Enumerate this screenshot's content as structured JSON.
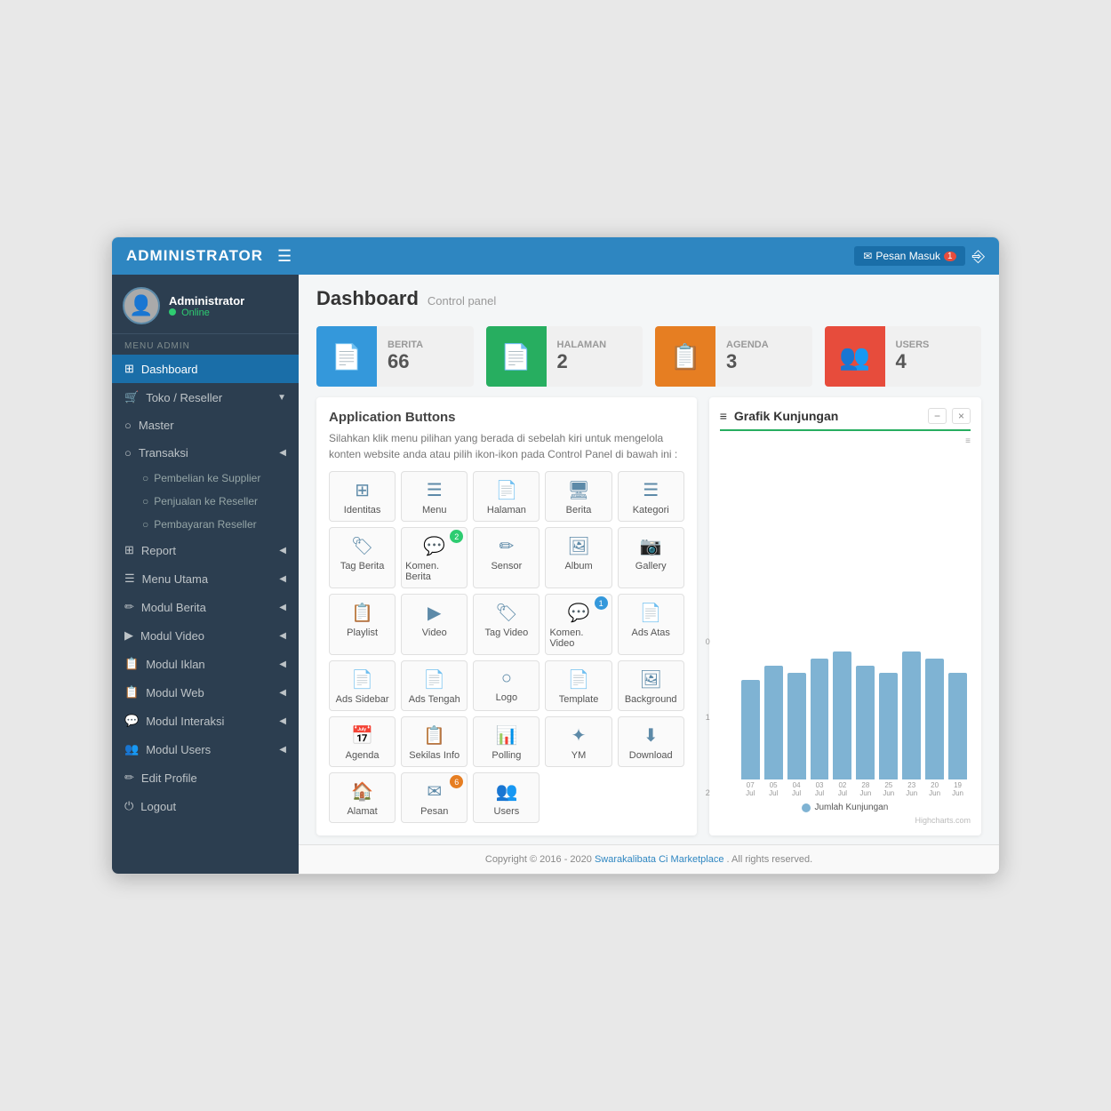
{
  "topbar": {
    "title": "ADMINISTRATOR",
    "pesan_masuk": "Pesan Masuk",
    "pesan_count": "1"
  },
  "sidebar": {
    "user": {
      "name": "Administrator",
      "status": "Online"
    },
    "menu_section": "MENU ADMIN",
    "items": [
      {
        "id": "dashboard",
        "label": "Dashboard",
        "icon": "⊞",
        "active": true
      },
      {
        "id": "toko-reseller",
        "label": "Toko / Reseller",
        "icon": "🛒",
        "has_sub": true,
        "expanded": false
      },
      {
        "id": "master",
        "label": "Master",
        "icon": "○"
      },
      {
        "id": "transaksi",
        "label": "Transaksi",
        "icon": "○",
        "has_sub": true,
        "expanded": true
      },
      {
        "id": "report",
        "label": "Report",
        "icon": "⊞",
        "has_sub": true
      },
      {
        "id": "menu-utama",
        "label": "Menu Utama",
        "icon": "☰",
        "has_sub": true
      },
      {
        "id": "modul-berita",
        "label": "Modul Berita",
        "icon": "✏",
        "has_sub": true
      },
      {
        "id": "modul-video",
        "label": "Modul Video",
        "icon": "▶",
        "has_sub": true
      },
      {
        "id": "modul-iklan",
        "label": "Modul Iklan",
        "icon": "📋",
        "has_sub": true
      },
      {
        "id": "modul-web",
        "label": "Modul Web",
        "icon": "📋",
        "has_sub": true
      },
      {
        "id": "modul-interaksi",
        "label": "Modul Interaksi",
        "icon": "💬",
        "has_sub": true
      },
      {
        "id": "modul-users",
        "label": "Modul Users",
        "icon": "👥",
        "has_sub": true
      },
      {
        "id": "edit-profile",
        "label": "Edit Profile",
        "icon": "✏"
      },
      {
        "id": "logout",
        "label": "Logout",
        "icon": "⏻"
      }
    ],
    "sub_transaksi": [
      {
        "id": "pembelian-supplier",
        "label": "Pembelian ke Supplier"
      },
      {
        "id": "penjualan-reseller",
        "label": "Penjualan ke Reseller"
      },
      {
        "id": "pembayaran-reseller",
        "label": "Pembayaran Reseller"
      }
    ]
  },
  "dashboard": {
    "title": "Dashboard",
    "subtitle": "Control panel",
    "stats": [
      {
        "id": "berita",
        "label": "BERITA",
        "value": "66",
        "color": "#3498db",
        "icon": "📄"
      },
      {
        "id": "halaman",
        "label": "HALAMAN",
        "value": "2",
        "color": "#27ae60",
        "icon": "📄"
      },
      {
        "id": "agenda",
        "label": "AGENDA",
        "value": "3",
        "color": "#e67e22",
        "icon": "📋"
      },
      {
        "id": "users",
        "label": "USERS",
        "value": "4",
        "color": "#e74c3c",
        "icon": "👥"
      }
    ]
  },
  "app_buttons": {
    "title": "Application Buttons",
    "desc": "Silahkan klik menu pilihan yang berada di sebelah kiri untuk mengelola konten website anda atau pilih ikon-ikon pada Control Panel di bawah ini :",
    "buttons": [
      {
        "id": "identitas",
        "label": "Identitas",
        "icon": "⊞",
        "badge": null
      },
      {
        "id": "menu",
        "label": "Menu",
        "icon": "☰",
        "badge": null
      },
      {
        "id": "halaman",
        "label": "Halaman",
        "icon": "📄",
        "badge": null
      },
      {
        "id": "berita",
        "label": "Berita",
        "icon": "🖥",
        "badge": null
      },
      {
        "id": "kategori",
        "label": "Kategori",
        "icon": "☰",
        "badge": null
      },
      {
        "id": "tag-berita",
        "label": "Tag Berita",
        "icon": "🏷",
        "badge": null
      },
      {
        "id": "komen-berita",
        "label": "Komen. Berita",
        "icon": "💬",
        "badge": "2"
      },
      {
        "id": "sensor",
        "label": "Sensor",
        "icon": "✏",
        "badge": null
      },
      {
        "id": "album",
        "label": "Album",
        "icon": "🖼",
        "badge": null
      },
      {
        "id": "gallery",
        "label": "Gallery",
        "icon": "📷",
        "badge": null
      },
      {
        "id": "playlist",
        "label": "Playlist",
        "icon": "📋",
        "badge": null
      },
      {
        "id": "video",
        "label": "Video",
        "icon": "▶",
        "badge": null
      },
      {
        "id": "tag-video",
        "label": "Tag Video",
        "icon": "🏷",
        "badge": null
      },
      {
        "id": "komen-video",
        "label": "Komen. Video",
        "icon": "💬",
        "badge": "1"
      },
      {
        "id": "ads-atas",
        "label": "Ads Atas",
        "icon": "📄",
        "badge": null
      },
      {
        "id": "ads-sidebar",
        "label": "Ads Sidebar",
        "icon": "📄",
        "badge": null
      },
      {
        "id": "ads-tengah",
        "label": "Ads Tengah",
        "icon": "📄",
        "badge": null
      },
      {
        "id": "logo",
        "label": "Logo",
        "icon": "○",
        "badge": null
      },
      {
        "id": "template",
        "label": "Template",
        "icon": "📄",
        "badge": null
      },
      {
        "id": "background",
        "label": "Background",
        "icon": "🖼",
        "badge": null
      },
      {
        "id": "agenda",
        "label": "Agenda",
        "icon": "📅",
        "badge": null
      },
      {
        "id": "sekilas-info",
        "label": "Sekilas Info",
        "icon": "📋",
        "badge": null
      },
      {
        "id": "polling",
        "label": "Polling",
        "icon": "📊",
        "badge": null
      },
      {
        "id": "ym",
        "label": "YM",
        "icon": "✦",
        "badge": null
      },
      {
        "id": "download",
        "label": "Download",
        "icon": "⬇",
        "badge": null
      },
      {
        "id": "alamat",
        "label": "Alamat",
        "icon": "🏠",
        "badge": null
      },
      {
        "id": "pesan",
        "label": "Pesan",
        "icon": "✉",
        "badge": "6"
      },
      {
        "id": "users",
        "label": "Users",
        "icon": "👥",
        "badge": null
      }
    ]
  },
  "grafik": {
    "title": "Grafik Kunjungan",
    "legend": "Jumlah Kunjungan",
    "credit": "Highcharts.com",
    "y_labels": [
      "2",
      "1",
      "0"
    ],
    "x_labels": [
      "07 Jul",
      "05 Jul",
      "04 Jul",
      "03 Jul",
      "02 Jul",
      "28 Jun",
      "25 Jun",
      "23 Jun",
      "20 Jun",
      "19 Jun"
    ],
    "bars": [
      1.4,
      1.6,
      1.5,
      1.7,
      1.8,
      1.6,
      1.5,
      1.8,
      1.7,
      1.5
    ]
  },
  "footer": {
    "copyright": "Copyright © 2016 - 2020",
    "company": "Swarakalibata Ci Marketplace",
    "rights": ". All rights reserved."
  }
}
